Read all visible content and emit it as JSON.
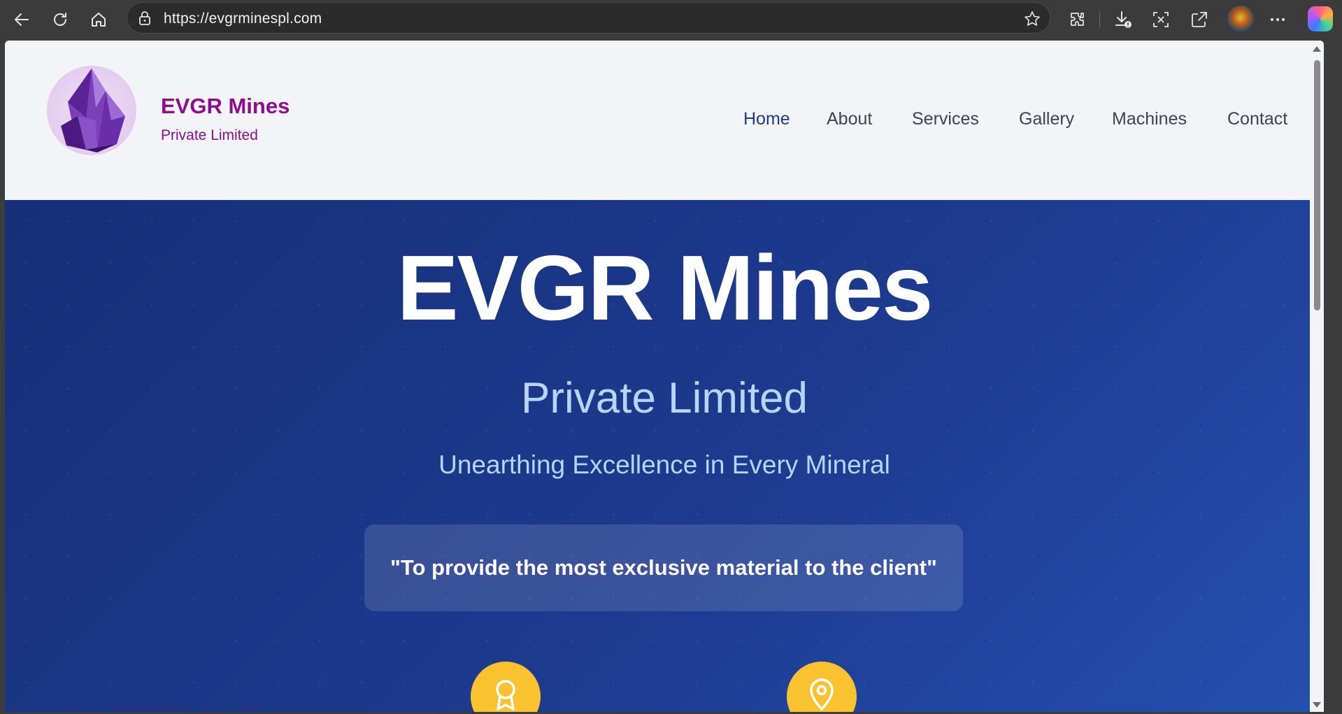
{
  "browser": {
    "url": "https://evgrminespl.com",
    "icons": [
      "back-icon",
      "refresh-icon",
      "home-icon",
      "lock-icon",
      "favorite-star-icon",
      "extensions-icon",
      "downloads-icon",
      "screenshot-icon",
      "share-icon",
      "profile-avatar",
      "more-icon",
      "copilot-icon"
    ]
  },
  "site": {
    "brand": {
      "name": "EVGR Mines",
      "tagline": "Private Limited",
      "color": "#8a0f8a"
    },
    "nav": {
      "items": [
        {
          "label": "Home",
          "active": true
        },
        {
          "label": "About",
          "active": false
        },
        {
          "label": "Services",
          "active": false
        },
        {
          "label": "Gallery",
          "active": false
        },
        {
          "label": "Machines",
          "active": false
        },
        {
          "label": "Contact",
          "active": false
        }
      ],
      "active_color": "#1e3a8a"
    },
    "hero": {
      "title": "EVGR Mines",
      "subtitle": "Private Limited",
      "tagline": "Unearthing Excellence in Every Mineral",
      "quote": "\"To provide the most exclusive material to the client\"",
      "feature_icons": [
        "award-icon",
        "location-pin-icon"
      ],
      "accent_color": "#f9c22e",
      "background_color": "#1d3a8e"
    }
  }
}
